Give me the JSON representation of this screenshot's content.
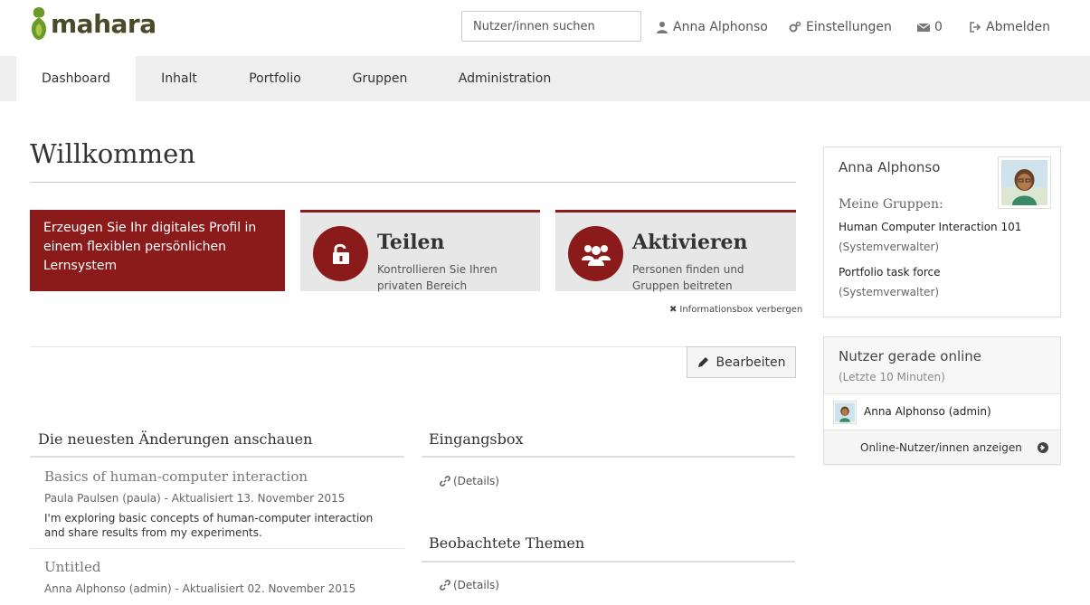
{
  "header": {
    "logo_text": "mahara",
    "search_placeholder": "Nutzer/innen suchen",
    "user_name": "Anna Alphonso",
    "settings_label": "Einstellungen",
    "messages_count": "0",
    "logout_label": "Abmelden"
  },
  "nav": {
    "tabs": [
      "Dashboard",
      "Inhalt",
      "Portfolio",
      "Gruppen",
      "Administration"
    ],
    "active": "Dashboard"
  },
  "main": {
    "title": "Willkommen",
    "infobox_red": "Erzeugen Sie Ihr digitales Profil in einem flexiblen persönlichen Lernsystem",
    "share": {
      "head": "Teilen",
      "sub": "Kontrollieren Sie Ihren privaten Bereich"
    },
    "engage": {
      "head": "Aktivieren",
      "sub": "Personen finden und Gruppen beitreten"
    },
    "hide_info": "Informationsbox verbergen",
    "edit_label": "Bearbeiten"
  },
  "latest": {
    "title": "Die neuesten Änderungen anschauen",
    "items": [
      {
        "title": "Basics of human-computer interaction",
        "meta": "Paula Paulsen (paula) - Aktualisiert 13. November 2015",
        "desc": "I'm exploring basic concepts of human-computer interaction and share results from my experiments."
      },
      {
        "title": "Untitled",
        "meta": "Anna Alphonso (admin) - Aktualisiert 02. November 2015",
        "desc": ""
      }
    ]
  },
  "inbox": {
    "title": "Eingangsbox",
    "details": "(Details)"
  },
  "watched": {
    "title": "Beobachtete Themen",
    "details": "(Details)"
  },
  "sidebar": {
    "profile": {
      "name": "Anna Alphonso",
      "groups_label": "Meine Gruppen:",
      "groups": [
        {
          "name": "Human Computer Interaction 101",
          "role": "(Systemverwalter)"
        },
        {
          "name": "Portfolio task force",
          "role": "(Systemverwalter)"
        }
      ]
    },
    "online": {
      "title": "Nutzer gerade online",
      "subtitle": "(Letzte 10 Minuten)",
      "user": "Anna Alphonso (admin)",
      "show_all": "Online-Nutzer/innen anzeigen"
    }
  },
  "colors": {
    "accent": "#8b1a1a",
    "logo_green": "#6a9a2a",
    "nav_bg": "#eeeeee"
  }
}
